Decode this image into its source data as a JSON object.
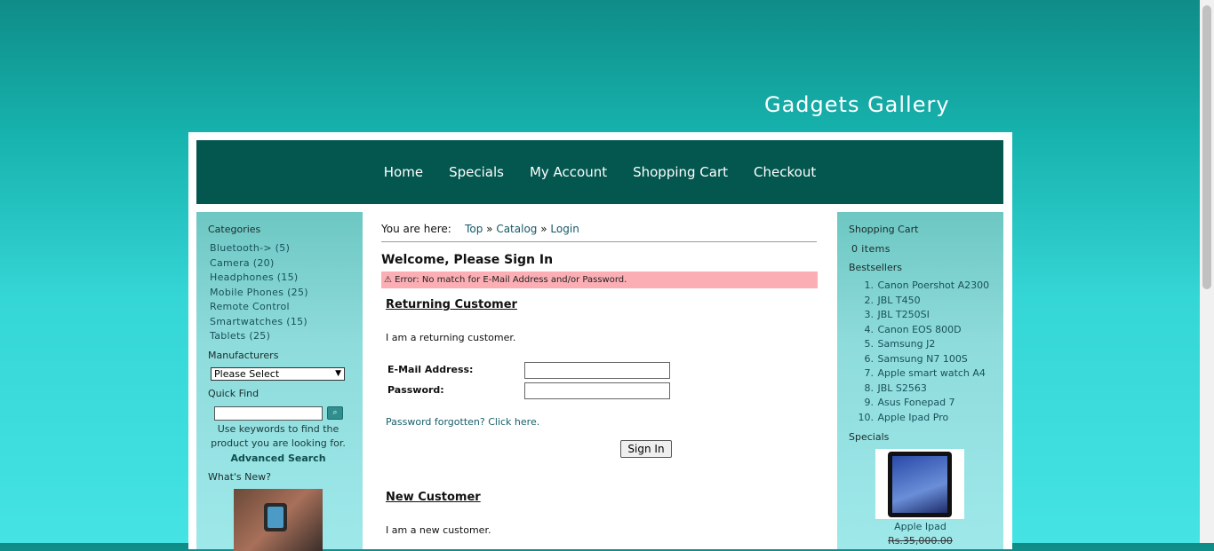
{
  "site": {
    "title": "Gadgets Gallery"
  },
  "nav": [
    "Home",
    "Specials",
    "My Account",
    "Shopping Cart",
    "Checkout"
  ],
  "left": {
    "categories_title": "Categories",
    "categories": [
      "Bluetooth-> (5)",
      "Camera (20)",
      "Headphones (15)",
      "Mobile Phones (25)",
      "Remote Control",
      "Smartwatches (15)",
      "Tablets (25)"
    ],
    "manufacturers_title": "Manufacturers",
    "manufacturer_select": "Please Select",
    "quickfind_title": "Quick Find",
    "quickfind_help": "Use keywords to find the product you are looking for.",
    "advanced_search": "Advanced Search",
    "whats_new_title": "What's New?"
  },
  "main": {
    "breadcrumb_prefix": "You are here:",
    "breadcrumb": [
      "Top",
      "Catalog",
      "Login"
    ],
    "breadcrumb_sep": "»",
    "heading": "Welcome, Please Sign In",
    "error": "Error: No match for E-Mail Address and/or Password.",
    "returning_title": "Returning Customer",
    "returning_text": "I am a returning customer.",
    "email_label": "E-Mail Address:",
    "password_label": "Password:",
    "email_value": "",
    "password_value": "",
    "forgot_text": "Password forgotten? Click here.",
    "signin_label": "Sign In",
    "new_title": "New Customer",
    "new_text": "I am a new customer."
  },
  "right": {
    "cart_title": "Shopping Cart",
    "cart_items": "0 items",
    "bestsellers_title": "Bestsellers",
    "bestsellers": [
      "Canon Poershot A2300",
      "JBL T450",
      "JBL T250SI",
      "Canon EOS 800D",
      "Samsung J2",
      "Samsung N7 100S",
      "Apple smart watch A4",
      "JBL S2563",
      "Asus Fonepad 7",
      "Apple Ipad Pro"
    ],
    "specials_title": "Specials",
    "special_name": "Apple Ipad",
    "special_price": "Rs.35,000.00"
  }
}
